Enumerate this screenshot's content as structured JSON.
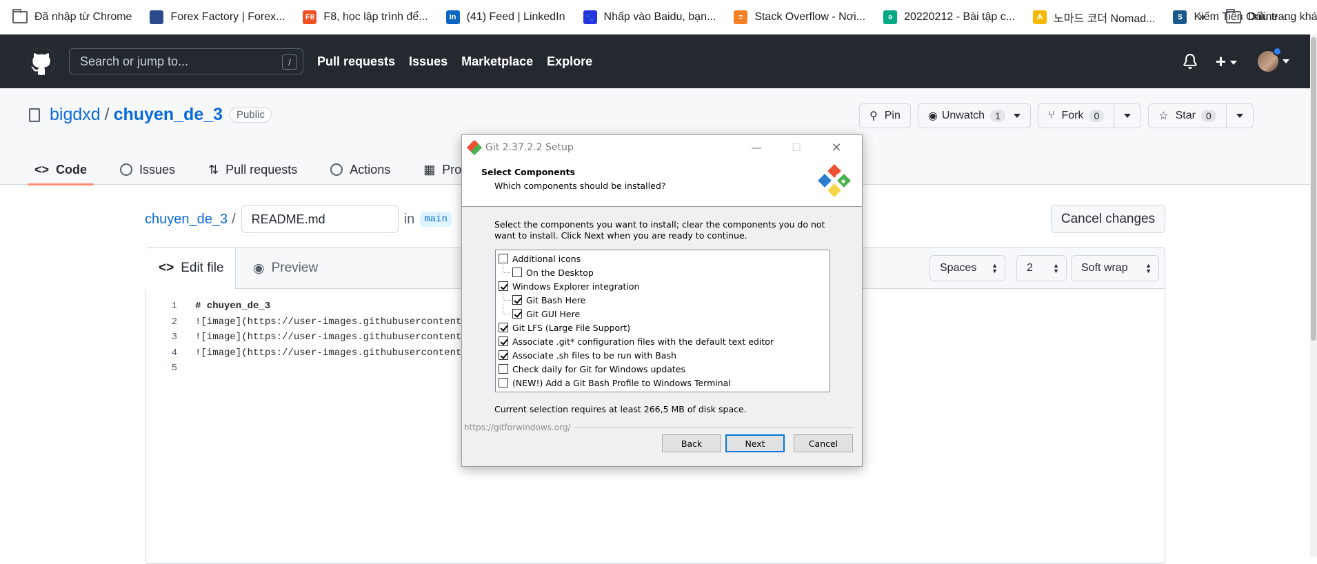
{
  "bookmarks": {
    "items": [
      {
        "label": "Đã nhập từ Chrome",
        "icon": "folder-icon"
      },
      {
        "label": "Forex Factory | Forex...",
        "icon": "forex-factory-icon",
        "color": "#2b4a8b"
      },
      {
        "label": "F8, học lập trình để...",
        "icon": "f8-icon",
        "color": "#f05123",
        "glyph": "F8"
      },
      {
        "label": "(41) Feed | LinkedIn",
        "icon": "linkedin-icon",
        "color": "#0a66c2",
        "glyph": "in"
      },
      {
        "label": "Nhấp vào Baidu, bạn...",
        "icon": "baidu-icon",
        "color": "#2932e1",
        "glyph": "🐾"
      },
      {
        "label": "Stack Overflow - Nơi...",
        "icon": "stackoverflow-icon",
        "color": "#f48024",
        "glyph": "≡"
      },
      {
        "label": "20220212 - Bài tập c...",
        "icon": "codelearn-icon",
        "color": "#00a884",
        "glyph": "ə"
      },
      {
        "label": "노마드 코더 Nomad...",
        "icon": "nomad-coders-icon",
        "color": "#f5b800",
        "glyph": "ᗑ"
      },
      {
        "label": "Kiếm Tiền Online -...",
        "icon": "kiem-tien-icon",
        "color": "#1a5a8a",
        "glyph": "$"
      }
    ],
    "more": "»",
    "other_label": "Dấu trang khác"
  },
  "github": {
    "search_placeholder": "Search or jump to...",
    "search_key": "/",
    "nav": [
      "Pull requests",
      "Issues",
      "Marketplace",
      "Explore"
    ],
    "plus": "+"
  },
  "repo": {
    "owner": "bigdxd",
    "sep": "/",
    "name": "chuyen_de_3",
    "visibility": "Public",
    "pin": "Pin",
    "unwatch": "Unwatch",
    "unwatch_count": "1",
    "fork": "Fork",
    "fork_count": "0",
    "star": "Star",
    "star_count": "0",
    "tabs": [
      "Code",
      "Issues",
      "Pull requests",
      "Actions",
      "Projects"
    ]
  },
  "editor": {
    "crumb_repo": "chuyen_de_3",
    "crumb_sep": "/",
    "filename": "README.md",
    "in": "in",
    "branch": "main",
    "cancel": "Cancel changes",
    "tab_edit": "Edit file",
    "tab_preview": "Preview",
    "indent_mode": "Spaces",
    "indent_size": "2",
    "wrap": "Soft wrap",
    "lines": [
      {
        "n": "1",
        "text": "# chuyen_de_3"
      },
      {
        "n": "2",
        "text": "![image](https://user-images.githubusercontent."
      },
      {
        "n": "3",
        "text": "![image](https://user-images.githubusercontent."
      },
      {
        "n": "4",
        "text": "![image](https://user-images.githubusercontent."
      },
      {
        "n": "5",
        "text": ""
      }
    ]
  },
  "dialog": {
    "title": "Git 2.37.2.2 Setup",
    "heading": "Select Components",
    "subheading": "Which components should be installed?",
    "intro": "Select the components you want to install; clear the components you do not want to install. Click Next when you are ready to continue.",
    "components": [
      {
        "label": "Additional icons",
        "checked": false,
        "level": 0
      },
      {
        "label": "On the Desktop",
        "checked": false,
        "level": 1
      },
      {
        "label": "Windows Explorer integration",
        "checked": true,
        "level": 0
      },
      {
        "label": "Git Bash Here",
        "checked": true,
        "level": 1
      },
      {
        "label": "Git GUI Here",
        "checked": true,
        "level": 1
      },
      {
        "label": "Git LFS (Large File Support)",
        "checked": true,
        "level": 0
      },
      {
        "label": "Associate .git* configuration files with the default text editor",
        "checked": true,
        "level": 0
      },
      {
        "label": "Associate .sh files to be run with Bash",
        "checked": true,
        "level": 0
      },
      {
        "label": "Check daily for Git for Windows updates",
        "checked": false,
        "level": 0
      },
      {
        "label": "(NEW!) Add a Git Bash Profile to Windows Terminal",
        "checked": false,
        "level": 0
      }
    ],
    "requirement": "Current selection requires at least 266,5 MB of disk space.",
    "link": "https://gitforwindows.org/",
    "back": "Back",
    "next": "Next",
    "cancel": "Cancel"
  }
}
